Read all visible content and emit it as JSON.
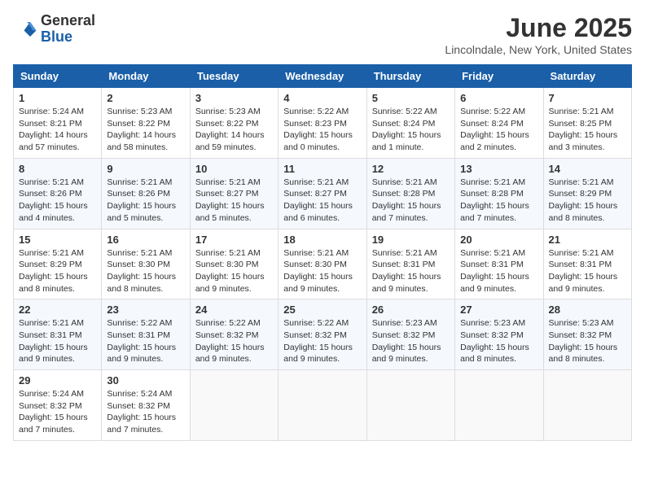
{
  "header": {
    "logo_general": "General",
    "logo_blue": "Blue",
    "title": "June 2025",
    "subtitle": "Lincolndale, New York, United States"
  },
  "calendar": {
    "days_of_week": [
      "Sunday",
      "Monday",
      "Tuesday",
      "Wednesday",
      "Thursday",
      "Friday",
      "Saturday"
    ],
    "weeks": [
      [
        {
          "day": "1",
          "sunrise": "5:24 AM",
          "sunset": "8:21 PM",
          "daylight": "14 hours and 57 minutes."
        },
        {
          "day": "2",
          "sunrise": "5:23 AM",
          "sunset": "8:22 PM",
          "daylight": "14 hours and 58 minutes."
        },
        {
          "day": "3",
          "sunrise": "5:23 AM",
          "sunset": "8:22 PM",
          "daylight": "14 hours and 59 minutes."
        },
        {
          "day": "4",
          "sunrise": "5:22 AM",
          "sunset": "8:23 PM",
          "daylight": "15 hours and 0 minutes."
        },
        {
          "day": "5",
          "sunrise": "5:22 AM",
          "sunset": "8:24 PM",
          "daylight": "15 hours and 1 minute."
        },
        {
          "day": "6",
          "sunrise": "5:22 AM",
          "sunset": "8:24 PM",
          "daylight": "15 hours and 2 minutes."
        },
        {
          "day": "7",
          "sunrise": "5:21 AM",
          "sunset": "8:25 PM",
          "daylight": "15 hours and 3 minutes."
        }
      ],
      [
        {
          "day": "8",
          "sunrise": "5:21 AM",
          "sunset": "8:26 PM",
          "daylight": "15 hours and 4 minutes."
        },
        {
          "day": "9",
          "sunrise": "5:21 AM",
          "sunset": "8:26 PM",
          "daylight": "15 hours and 5 minutes."
        },
        {
          "day": "10",
          "sunrise": "5:21 AM",
          "sunset": "8:27 PM",
          "daylight": "15 hours and 5 minutes."
        },
        {
          "day": "11",
          "sunrise": "5:21 AM",
          "sunset": "8:27 PM",
          "daylight": "15 hours and 6 minutes."
        },
        {
          "day": "12",
          "sunrise": "5:21 AM",
          "sunset": "8:28 PM",
          "daylight": "15 hours and 7 minutes."
        },
        {
          "day": "13",
          "sunrise": "5:21 AM",
          "sunset": "8:28 PM",
          "daylight": "15 hours and 7 minutes."
        },
        {
          "day": "14",
          "sunrise": "5:21 AM",
          "sunset": "8:29 PM",
          "daylight": "15 hours and 8 minutes."
        }
      ],
      [
        {
          "day": "15",
          "sunrise": "5:21 AM",
          "sunset": "8:29 PM",
          "daylight": "15 hours and 8 minutes."
        },
        {
          "day": "16",
          "sunrise": "5:21 AM",
          "sunset": "8:30 PM",
          "daylight": "15 hours and 8 minutes."
        },
        {
          "day": "17",
          "sunrise": "5:21 AM",
          "sunset": "8:30 PM",
          "daylight": "15 hours and 9 minutes."
        },
        {
          "day": "18",
          "sunrise": "5:21 AM",
          "sunset": "8:30 PM",
          "daylight": "15 hours and 9 minutes."
        },
        {
          "day": "19",
          "sunrise": "5:21 AM",
          "sunset": "8:31 PM",
          "daylight": "15 hours and 9 minutes."
        },
        {
          "day": "20",
          "sunrise": "5:21 AM",
          "sunset": "8:31 PM",
          "daylight": "15 hours and 9 minutes."
        },
        {
          "day": "21",
          "sunrise": "5:21 AM",
          "sunset": "8:31 PM",
          "daylight": "15 hours and 9 minutes."
        }
      ],
      [
        {
          "day": "22",
          "sunrise": "5:21 AM",
          "sunset": "8:31 PM",
          "daylight": "15 hours and 9 minutes."
        },
        {
          "day": "23",
          "sunrise": "5:22 AM",
          "sunset": "8:31 PM",
          "daylight": "15 hours and 9 minutes."
        },
        {
          "day": "24",
          "sunrise": "5:22 AM",
          "sunset": "8:32 PM",
          "daylight": "15 hours and 9 minutes."
        },
        {
          "day": "25",
          "sunrise": "5:22 AM",
          "sunset": "8:32 PM",
          "daylight": "15 hours and 9 minutes."
        },
        {
          "day": "26",
          "sunrise": "5:23 AM",
          "sunset": "8:32 PM",
          "daylight": "15 hours and 9 minutes."
        },
        {
          "day": "27",
          "sunrise": "5:23 AM",
          "sunset": "8:32 PM",
          "daylight": "15 hours and 8 minutes."
        },
        {
          "day": "28",
          "sunrise": "5:23 AM",
          "sunset": "8:32 PM",
          "daylight": "15 hours and 8 minutes."
        }
      ],
      [
        {
          "day": "29",
          "sunrise": "5:24 AM",
          "sunset": "8:32 PM",
          "daylight": "15 hours and 7 minutes."
        },
        {
          "day": "30",
          "sunrise": "5:24 AM",
          "sunset": "8:32 PM",
          "daylight": "15 hours and 7 minutes."
        },
        null,
        null,
        null,
        null,
        null
      ]
    ]
  }
}
